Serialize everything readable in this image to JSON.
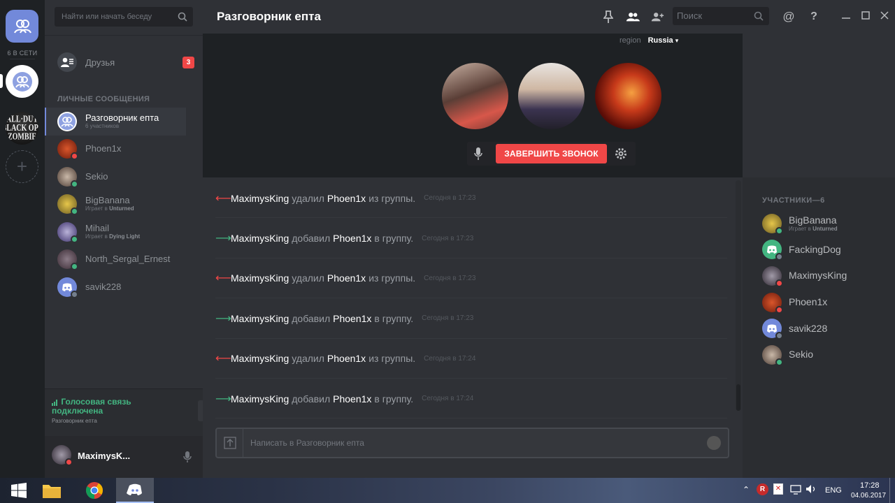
{
  "guilds": {
    "online_count": "6 В СЕТИ"
  },
  "sidebar": {
    "search_placeholder": "Найти или начать беседу",
    "friends_label": "Друзья",
    "friends_badge": "3",
    "dm_header": "ЛИЧНЫЕ СООБЩЕНИЯ",
    "dms": [
      {
        "name": "Разговорник епта",
        "sub": "6 участников",
        "type": "group"
      },
      {
        "name": "Phoen1x",
        "status": "dnd"
      },
      {
        "name": "Sekio",
        "status": "online"
      },
      {
        "name": "BigBanana",
        "status": "online",
        "sub_prefix": "Играет в",
        "sub_game": "Unturned"
      },
      {
        "name": "Mihail",
        "status": "online",
        "sub_prefix": "Играет в",
        "sub_game": "Dying Light"
      },
      {
        "name": "North_Sergal_Ernest",
        "status": "online"
      },
      {
        "name": "savik228",
        "status": "offline"
      }
    ],
    "voice_status": "Голосовая связь подключена",
    "voice_sub": "Разговорник епта",
    "username": "MaximysK..."
  },
  "header": {
    "title": "Разговорник епта",
    "search_placeholder": "Поиск",
    "region_label": "region",
    "region_value": "Russia"
  },
  "call": {
    "end_call_label": "ЗАВЕРШИТЬ ЗВОНОК"
  },
  "messages": [
    {
      "dir": "left",
      "user": "MaximysKing",
      "verb": "удалил",
      "target": "Phoen1x",
      "rest": "из группы.",
      "time": "Сегодня в 17:23"
    },
    {
      "dir": "right",
      "user": "MaximysKing",
      "verb": "добавил",
      "target": "Phoen1x",
      "rest": "в группу.",
      "time": "Сегодня в 17:23"
    },
    {
      "dir": "left",
      "user": "MaximysKing",
      "verb": "удалил",
      "target": "Phoen1x",
      "rest": "из группы.",
      "time": "Сегодня в 17:23"
    },
    {
      "dir": "right",
      "user": "MaximysKing",
      "verb": "добавил",
      "target": "Phoen1x",
      "rest": "в группу.",
      "time": "Сегодня в 17:23"
    },
    {
      "dir": "left",
      "user": "MaximysKing",
      "verb": "удалил",
      "target": "Phoen1x",
      "rest": "из группы.",
      "time": "Сегодня в 17:24"
    },
    {
      "dir": "right",
      "user": "MaximysKing",
      "verb": "добавил",
      "target": "Phoen1x",
      "rest": "в группу.",
      "time": "Сегодня в 17:24"
    }
  ],
  "composer": {
    "placeholder": "Написать в Разговорник епта"
  },
  "members": {
    "header": "УЧАСТНИКИ—6",
    "list": [
      {
        "name": "BigBanana",
        "status": "online",
        "sub_prefix": "Играет в",
        "sub_game": "Unturned"
      },
      {
        "name": "FackingDog",
        "status": "offline"
      },
      {
        "name": "MaximysKing",
        "status": "dnd"
      },
      {
        "name": "Phoen1x",
        "status": "dnd"
      },
      {
        "name": "savik228",
        "status": "offline"
      },
      {
        "name": "Sekio",
        "status": "online"
      }
    ]
  },
  "taskbar": {
    "lang": "ENG",
    "time": "17:28",
    "date": "04.06.2017"
  },
  "colors": {
    "accent": "#7289da",
    "danger": "#f04747",
    "online": "#43b581",
    "offline": "#747f8d"
  }
}
